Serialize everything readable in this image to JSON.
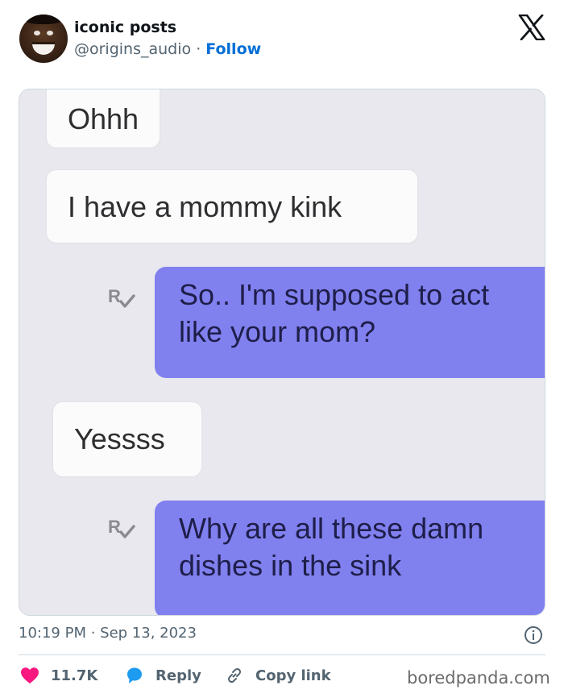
{
  "post": {
    "author_name": "iconic posts",
    "handle": "@origins_audio",
    "separator": " · ",
    "follow_label": "Follow",
    "brand_icon": "x-logo-icon",
    "timestamp": "10:19 PM · Sep 13, 2023"
  },
  "media": {
    "messages": [
      {
        "side": "incoming",
        "text": "Ohhh"
      },
      {
        "side": "incoming",
        "text": "I have a mommy kink"
      },
      {
        "side": "outgoing",
        "lines": [
          "So.. I'm supposed to act",
          "like your mom?"
        ]
      },
      {
        "side": "incoming",
        "text": "Yessss"
      },
      {
        "side": "outgoing",
        "lines": [
          "Why are all these damn",
          "dishes in the sink"
        ]
      }
    ],
    "read_icon": "read-receipt-icon"
  },
  "actions": {
    "likes": "11.7K",
    "reply_label": "Reply",
    "copy_link_label": "Copy link"
  },
  "watermark": "boredpanda.com",
  "colors": {
    "accent": "#006fd6",
    "like": "#f91880",
    "reply": "#1d9bf0",
    "outgoing_bubble": "#8080ef",
    "incoming_bubble": "#fbfbfc"
  }
}
